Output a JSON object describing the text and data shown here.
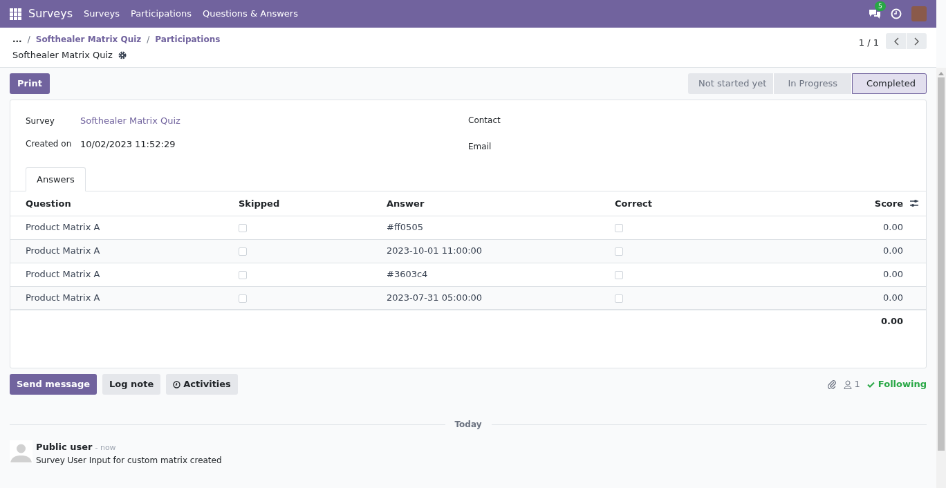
{
  "navbar": {
    "app_name": "Surveys",
    "menu": [
      "Surveys",
      "Participations",
      "Questions & Answers"
    ],
    "messages_count": "5"
  },
  "breadcrumb": {
    "ellipsis": "...",
    "separator": "/",
    "items": [
      "Softhealer Matrix Quiz",
      "Participations"
    ],
    "current": "Softhealer Matrix Quiz"
  },
  "pager": {
    "text": "1 / 1"
  },
  "actions": [
    "Print"
  ],
  "stages": [
    {
      "label": "Not started yet",
      "selected": false
    },
    {
      "label": "In Progress",
      "selected": false
    },
    {
      "label": "Completed",
      "selected": true
    }
  ],
  "fields_left": [
    {
      "label": "Survey",
      "value": "Softhealer Matrix Quiz",
      "kind": "link"
    },
    {
      "label": "Created on",
      "value": "10/02/2023 11:52:29",
      "kind": "text"
    }
  ],
  "fields_right": [
    {
      "label": "Contact"
    },
    {
      "label": "Email"
    }
  ],
  "tabs": [
    {
      "label": "Answers",
      "selected": true
    }
  ],
  "table": {
    "columns": [
      "Question",
      "Skipped",
      "Answer",
      "Correct",
      "Score"
    ],
    "rows": [
      {
        "question": "Product Matrix A",
        "skipped": false,
        "answer": "#ff0505",
        "correct": false,
        "score": "0.00"
      },
      {
        "question": "Product Matrix A",
        "skipped": false,
        "answer": "2023-10-01 11:00:00",
        "correct": false,
        "score": "0.00"
      },
      {
        "question": "Product Matrix A",
        "skipped": false,
        "answer": "#3603c4",
        "correct": false,
        "score": "0.00"
      },
      {
        "question": "Product Matrix A",
        "skipped": false,
        "answer": "2023-07-31 05:00:00",
        "correct": false,
        "score": "0.00"
      }
    ],
    "total": "0.00"
  },
  "chatter": {
    "buttons": [
      {
        "label": "Send message",
        "kind": "primary"
      },
      {
        "label": "Log note",
        "kind": "secondary"
      },
      {
        "label": "Activities",
        "kind": "activities"
      }
    ],
    "followers": "1",
    "follow_status": "Following",
    "date_separator": "Today",
    "messages": [
      {
        "author": "Public user",
        "time": "- now",
        "body": "Survey User Input for custom matrix created"
      }
    ]
  }
}
